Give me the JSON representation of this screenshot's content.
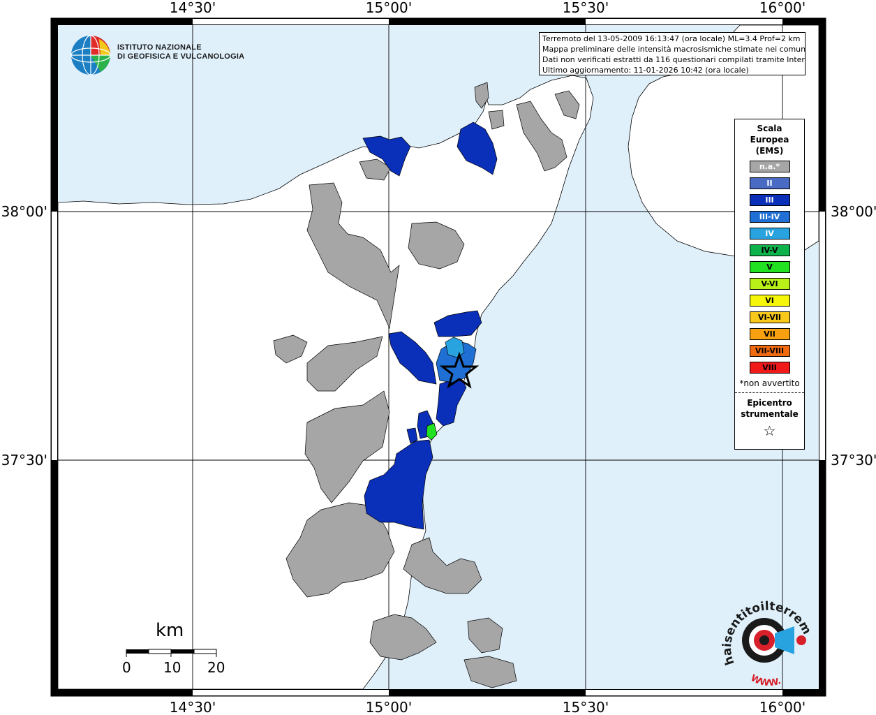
{
  "map": {
    "lon_labels": [
      "14°30'",
      "15°00'",
      "15°30'",
      "16°00'"
    ],
    "lat_labels": [
      "38°00'",
      "37°30'"
    ],
    "info_lines": [
      "Terremoto del 13-05-2009 16:13:47 (ora locale) ML=3.4 Prof=2 km",
      "Mappa preliminare delle intensità macrosismiche stimate nei comuni",
      "Dati non verificati estratti da 116 questionari compilati tramite Internet.",
      "Ultimo aggiornamento: 11-01-2026 10:42 (ora locale)"
    ],
    "logo_line1": "ISTITUTO NAZIONALE",
    "logo_line2": "DI GEOFISICA E VULCANOLOGIA",
    "scale_title": "km",
    "scale_ticks": [
      "0",
      "10",
      "20"
    ],
    "hst_text": "haisentitoilterremoto.it",
    "hst_www": "WWW.",
    "colors": {
      "sea": "#dff0fb",
      "land": "#ffffff",
      "na": "#a6a6a6",
      "II": "#4a6bc4",
      "III": "#0a2fb8",
      "III-IV": "#1f6fd4",
      "IV": "#29a3e0"
    }
  },
  "legend": {
    "title": [
      "Scala",
      "Europea",
      "(EMS)"
    ],
    "items": [
      {
        "label": "n.a.*",
        "color": "#a6a6a6",
        "dark": false
      },
      {
        "label": "II",
        "color": "#4a6bc4",
        "dark": false
      },
      {
        "label": "III",
        "color": "#0a2fb8",
        "dark": false
      },
      {
        "label": "III-IV",
        "color": "#1f6fd4",
        "dark": false
      },
      {
        "label": "IV",
        "color": "#29a3e0",
        "dark": false
      },
      {
        "label": "IV-V",
        "color": "#0db24a",
        "dark": true
      },
      {
        "label": "V",
        "color": "#22e022",
        "dark": true
      },
      {
        "label": "V-VI",
        "color": "#b8f018",
        "dark": true
      },
      {
        "label": "VI",
        "color": "#f6f60a",
        "dark": true
      },
      {
        "label": "VI-VII",
        "color": "#f8c81a",
        "dark": true
      },
      {
        "label": "VII",
        "color": "#f8a010",
        "dark": true
      },
      {
        "label": "VII-VIII",
        "color": "#f06a10",
        "dark": true
      },
      {
        "label": "VIII",
        "color": "#f01a1a",
        "dark": true
      }
    ],
    "note": "*non avvertito",
    "epicentro": [
      "Epicentro",
      "strumentale"
    ],
    "star": "☆"
  }
}
